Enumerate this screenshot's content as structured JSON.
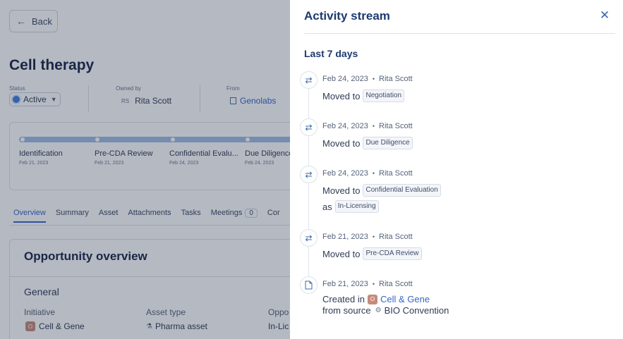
{
  "background": {
    "back_label": "Back",
    "page_title": "Cell therapy",
    "status_label": "Status",
    "status_value": "Active",
    "owned_by_label": "Owned by",
    "owner_initials": "RS",
    "owner_name": "Rita Scott",
    "from_label": "From",
    "from_value": "Genolabs",
    "stages": [
      {
        "name": "Identification",
        "date": "Feb 21, 2023"
      },
      {
        "name": "Pre-CDA Review",
        "date": "Feb 21, 2023"
      },
      {
        "name": "Confidential Evalu...",
        "date": "Feb 24, 2023"
      },
      {
        "name": "Due Diligence",
        "date": "Feb 24, 2023"
      }
    ],
    "tabs": [
      {
        "label": "Overview"
      },
      {
        "label": "Summary"
      },
      {
        "label": "Asset"
      },
      {
        "label": "Attachments"
      },
      {
        "label": "Tasks"
      },
      {
        "label": "Meetings",
        "count": "0"
      },
      {
        "label": "Cor"
      }
    ],
    "overview_title": "Opportunity overview",
    "general_label": "General",
    "initiative_label": "Initiative",
    "initiative_badge": "O",
    "initiative_value": "Cell & Gene",
    "asset_type_label": "Asset type",
    "asset_type_value": "Pharma asset",
    "oppo_label": "Oppo",
    "oppo_value": "In-Lic"
  },
  "drawer": {
    "title": "Activity stream",
    "period": "Last 7 days",
    "events": [
      {
        "date": "Feb 24, 2023",
        "user": "Rita Scott",
        "verb": "Moved to",
        "chip": "Negotiation",
        "icon": "swap-arrows-icon"
      },
      {
        "date": "Feb 24, 2023",
        "user": "Rita Scott",
        "verb": "Moved to",
        "chip": "Due Diligence",
        "icon": "swap-arrows-icon"
      },
      {
        "date": "Feb 24, 2023",
        "user": "Rita Scott",
        "verb": "Moved to",
        "chip": "Confidential Evaluation",
        "as_word": "as",
        "chip2": "In-Licensing",
        "icon": "swap-arrows-icon"
      },
      {
        "date": "Feb 21, 2023",
        "user": "Rita Scott",
        "verb": "Moved to",
        "chip": "Pre-CDA Review",
        "icon": "swap-arrows-icon"
      },
      {
        "date": "Feb 21, 2023",
        "user": "Rita Scott",
        "verb": "Created in",
        "badge": "O",
        "link": "Cell & Gene",
        "source_label": "from source",
        "source_value": "BIO Convention",
        "icon": "document-icon"
      }
    ]
  }
}
